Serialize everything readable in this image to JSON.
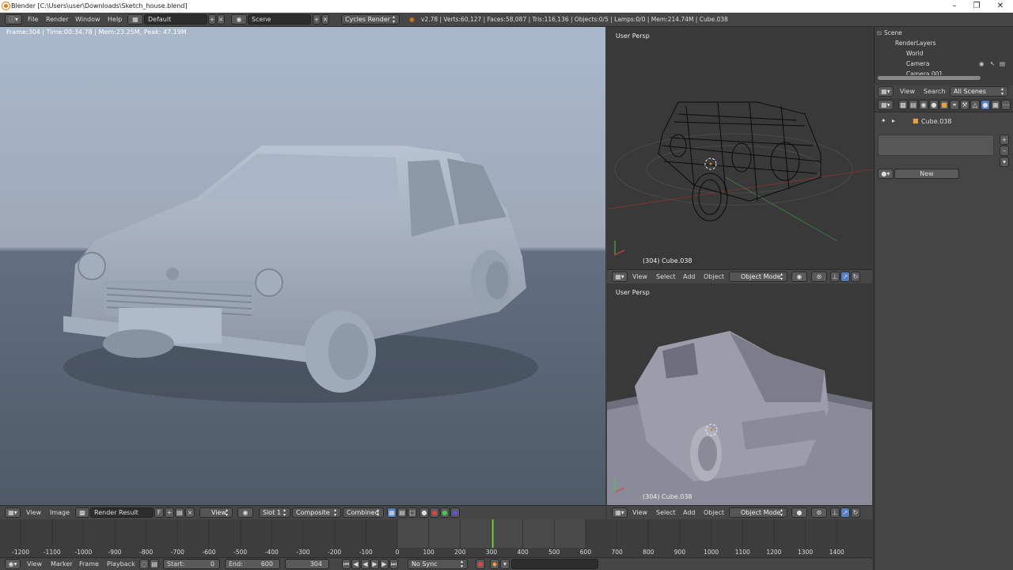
{
  "window": {
    "title": "Blender [C:\\Users\\user\\Downloads\\Sketch_house.blend]"
  },
  "topbar": {
    "menus": [
      "File",
      "Render",
      "Window",
      "Help"
    ],
    "layout": "Default",
    "scene": "Scene",
    "engine": "Cycles Render",
    "stats": "v2.78 | Verts:60,127 | Faces:58,087 | Tris:116,136 | Objects:0/5 | Lamps:0/0 | Mem:214.74M | Cube.038"
  },
  "render_view": {
    "info": "Frame:304 | Time:00:34.78 | Mem:23.25M, Peak: 47.19M",
    "header": {
      "menus": [
        "View",
        "Image"
      ],
      "image_name": "Render Result",
      "f_label": "F",
      "view": "View",
      "slot": "Slot 1",
      "composite": "Composite",
      "pass": "Combined"
    }
  },
  "viewport_top": {
    "label": "User Persp",
    "object_label": "(304) Cube.038",
    "menus": [
      "View",
      "Select",
      "Add",
      "Object"
    ],
    "mode": "Object Mode"
  },
  "viewport_bottom": {
    "label": "User Persp",
    "object_label": "(304) Cube.038",
    "menus": [
      "View",
      "Select",
      "Add",
      "Object"
    ],
    "mode": "Object Mode"
  },
  "outliner": {
    "items": [
      "Scene",
      "RenderLayers",
      "World",
      "Camera",
      "Camera.001"
    ]
  },
  "properties": {
    "menus": [
      "View",
      "Search"
    ],
    "scenes": "All Scenes",
    "object": "Cube.038",
    "new_button": "New"
  },
  "timeline": {
    "ticks": [
      "-1200",
      "-1100",
      "-1000",
      "-900",
      "-800",
      "-700",
      "-600",
      "-500",
      "-400",
      "-300",
      "-200",
      "-100",
      "0",
      "100",
      "200",
      "300",
      "400",
      "500",
      "600",
      "700",
      "800",
      "900",
      "1000",
      "1100",
      "1200",
      "1300",
      "1400"
    ],
    "current_frame_value": 304,
    "header": {
      "menus": [
        "View",
        "Marker",
        "Frame",
        "Playback"
      ],
      "start_label": "Start:",
      "start_value": "0",
      "end_label": "End:",
      "end_value": "600",
      "current": "304",
      "sync": "No Sync"
    }
  },
  "colors": {
    "accent_green": "#6fd33c",
    "header_bg": "#464646",
    "blender_orange": "#e87d0d"
  }
}
